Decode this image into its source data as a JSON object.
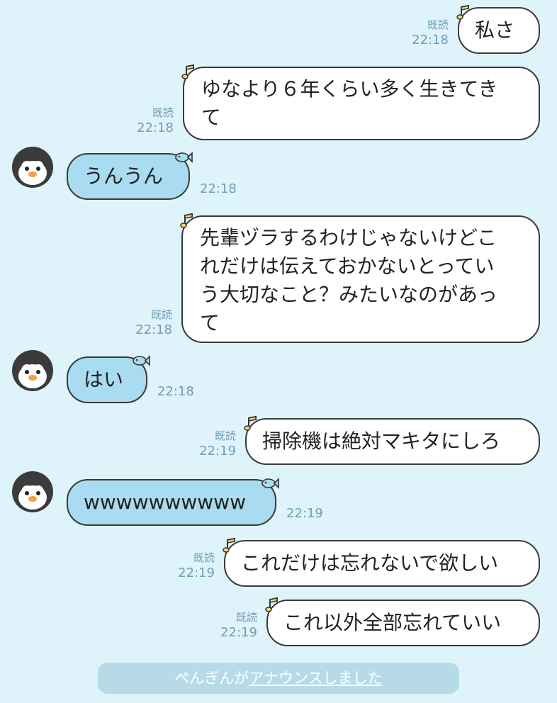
{
  "messages": [
    {
      "text": "私さ",
      "read": "既読",
      "time": "22:18"
    },
    {
      "text": "ゆなより６年くらい多く生きてき\nて",
      "read": "既読",
      "time": "22:18"
    },
    {
      "text": "うんうん",
      "time": "22:18"
    },
    {
      "text": "先輩ヅラするわけじゃないけどこ\nれだけは伝えておかないとってい\nう大切なこと？みたいなのがあっ\nて",
      "read": "既読",
      "time": "22:18"
    },
    {
      "text": "はい",
      "time": "22:18"
    },
    {
      "text": "掃除機は絶対マキタにしろ",
      "read": "既読",
      "time": "22:19"
    },
    {
      "text": "wwwwwwwwww",
      "time": "22:19"
    },
    {
      "text": "これだけは忘れないで欲しい",
      "read": "既読",
      "time": "22:19"
    },
    {
      "text": "これ以外全部忘れていい",
      "read": "既読",
      "time": "22:19"
    }
  ],
  "announcement": {
    "prefix": "ぺんぎんが",
    "link": "アナウンスしました"
  },
  "icons": {
    "avatar": "penguin-avatar-icon",
    "out_deco": "music-note-icon",
    "in_deco": "fish-icon"
  },
  "colors": {
    "background": "#dff3fb",
    "outgoing": "#ffffff",
    "incoming": "#a9dcf0",
    "meta": "#6f9fb4"
  }
}
